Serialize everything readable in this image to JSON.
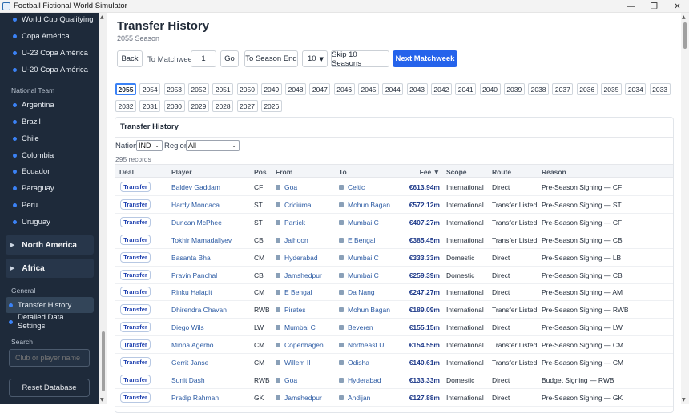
{
  "window": {
    "title": "Football Fictional World Simulator",
    "minimize": "—",
    "maximize": "❐",
    "close": "✕"
  },
  "sidebar": {
    "competitions": [
      "World Cup Qualifying",
      "Copa América",
      "U-23 Copa América",
      "U-20 Copa América"
    ],
    "national_team_label": "National Team",
    "national_teams": [
      "Argentina",
      "Brazil",
      "Chile",
      "Colombia",
      "Ecuador",
      "Paraguay",
      "Peru",
      "Uruguay"
    ],
    "groups": [
      {
        "label": "North America",
        "caret": "▶"
      },
      {
        "label": "Africa",
        "caret": "▶"
      }
    ],
    "general_label": "General",
    "general_items": [
      "Transfer History",
      "Detailed Data Settings"
    ],
    "search_label": "Search",
    "search_placeholder": "Club or player name",
    "reset_label": "Reset Database"
  },
  "header": {
    "title": "Transfer History",
    "subtitle": "2055 Season"
  },
  "toolbar": {
    "back": "Back",
    "to_matchweek": "To Matchweek",
    "matchweek_value": "1",
    "go": "Go",
    "to_season_end": "To Season End",
    "skip_count": "10",
    "skip": "Skip 10 Seasons",
    "next": "Next Matchweek"
  },
  "seasons": [
    "2055",
    "2054",
    "2053",
    "2052",
    "2051",
    "2050",
    "2049",
    "2048",
    "2047",
    "2046",
    "2045",
    "2044",
    "2043",
    "2042",
    "2041",
    "2040",
    "2039",
    "2038",
    "2037",
    "2036",
    "2035",
    "2034",
    "2033",
    "2032",
    "2031",
    "2030",
    "2029",
    "2028",
    "2027",
    "2026"
  ],
  "active_season": "2055",
  "card": {
    "title": "Transfer History",
    "nation_label": "Nation",
    "nation_value": "IND",
    "region_label": "Region",
    "region_value": "All",
    "records": "295 records",
    "columns": {
      "deal": "Deal",
      "player": "Player",
      "pos": "Pos",
      "from": "From",
      "to": "To",
      "fee": "Fee ▼",
      "scope": "Scope",
      "route": "Route",
      "reason": "Reason"
    },
    "rows": [
      {
        "deal": "Transfer",
        "player": "Baldev Gaddam",
        "pos": "CF",
        "from": "Goa",
        "to": "Celtic",
        "fee": "€613.94m",
        "scope": "International",
        "route": "Direct",
        "reason": "Pre-Season Signing — CF"
      },
      {
        "deal": "Transfer",
        "player": "Hardy Mondaca",
        "pos": "ST",
        "from": "Criciúma",
        "to": "Mohun Bagan",
        "fee": "€572.12m",
        "scope": "International",
        "route": "Transfer Listed",
        "reason": "Pre-Season Signing — ST"
      },
      {
        "deal": "Transfer",
        "player": "Duncan McPhee",
        "pos": "ST",
        "from": "Partick",
        "to": "Mumbai C",
        "fee": "€407.27m",
        "scope": "International",
        "route": "Transfer Listed",
        "reason": "Pre-Season Signing — CF"
      },
      {
        "deal": "Transfer",
        "player": "Tokhir Mamadaliyev",
        "pos": "CB",
        "from": "Jaihoon",
        "to": "E Bengal",
        "fee": "€385.45m",
        "scope": "International",
        "route": "Transfer Listed",
        "reason": "Pre-Season Signing — CB"
      },
      {
        "deal": "Transfer",
        "player": "Basanta Bha",
        "pos": "CM",
        "from": "Hyderabad",
        "to": "Mumbai C",
        "fee": "€333.33m",
        "scope": "Domestic",
        "route": "Direct",
        "reason": "Pre-Season Signing — LB"
      },
      {
        "deal": "Transfer",
        "player": "Pravin Panchal",
        "pos": "CB",
        "from": "Jamshedpur",
        "to": "Mumbai C",
        "fee": "€259.39m",
        "scope": "Domestic",
        "route": "Direct",
        "reason": "Pre-Season Signing — CB"
      },
      {
        "deal": "Transfer",
        "player": "Rinku Halapit",
        "pos": "CM",
        "from": "E Bengal",
        "to": "Da Nang",
        "fee": "€247.27m",
        "scope": "International",
        "route": "Direct",
        "reason": "Pre-Season Signing — AM"
      },
      {
        "deal": "Transfer",
        "player": "Dhirendra Chavan",
        "pos": "RWB",
        "from": "Pirates",
        "to": "Mohun Bagan",
        "fee": "€189.09m",
        "scope": "International",
        "route": "Transfer Listed",
        "reason": "Pre-Season Signing — RWB"
      },
      {
        "deal": "Transfer",
        "player": "Diego Wils",
        "pos": "LW",
        "from": "Mumbai C",
        "to": "Beveren",
        "fee": "€155.15m",
        "scope": "International",
        "route": "Direct",
        "reason": "Pre-Season Signing — LW"
      },
      {
        "deal": "Transfer",
        "player": "Minna Agerbo",
        "pos": "CM",
        "from": "Copenhagen",
        "to": "Northeast U",
        "fee": "€154.55m",
        "scope": "International",
        "route": "Transfer Listed",
        "reason": "Pre-Season Signing — CM"
      },
      {
        "deal": "Transfer",
        "player": "Gerrit Janse",
        "pos": "CM",
        "from": "Willem II",
        "to": "Odisha",
        "fee": "€140.61m",
        "scope": "International",
        "route": "Transfer Listed",
        "reason": "Pre-Season Signing — CM"
      },
      {
        "deal": "Transfer",
        "player": "Sunit Dash",
        "pos": "RWB",
        "from": "Goa",
        "to": "Hyderabad",
        "fee": "€133.33m",
        "scope": "Domestic",
        "route": "Direct",
        "reason": "Budget Signing — RWB"
      },
      {
        "deal": "Transfer",
        "player": "Pradip Rahman",
        "pos": "GK",
        "from": "Jamshedpur",
        "to": "Andijan",
        "fee": "€127.88m",
        "scope": "International",
        "route": "Direct",
        "reason": "Pre-Season Signing — GK"
      }
    ]
  }
}
